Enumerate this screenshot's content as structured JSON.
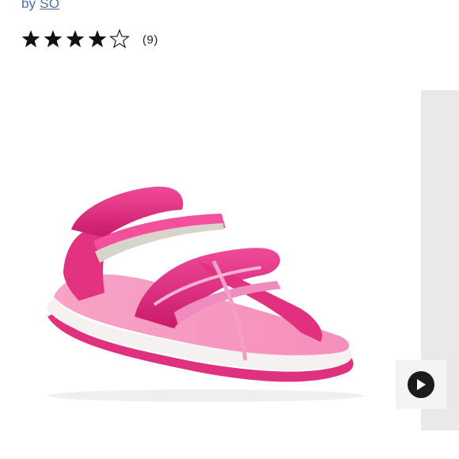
{
  "product": {
    "by_prefix": "by",
    "brand": "SO"
  },
  "rating": {
    "stars": 4,
    "max": 5,
    "review_count": "(9)"
  },
  "media": {
    "main_image": "pink-sandal-photo",
    "video_button": "play-icon"
  },
  "colors": {
    "link": "#4a6fa1",
    "sandal_pink": "#e5287e",
    "thumb_bg": "#e9e9e9",
    "play_button": "#1b1b1b"
  }
}
